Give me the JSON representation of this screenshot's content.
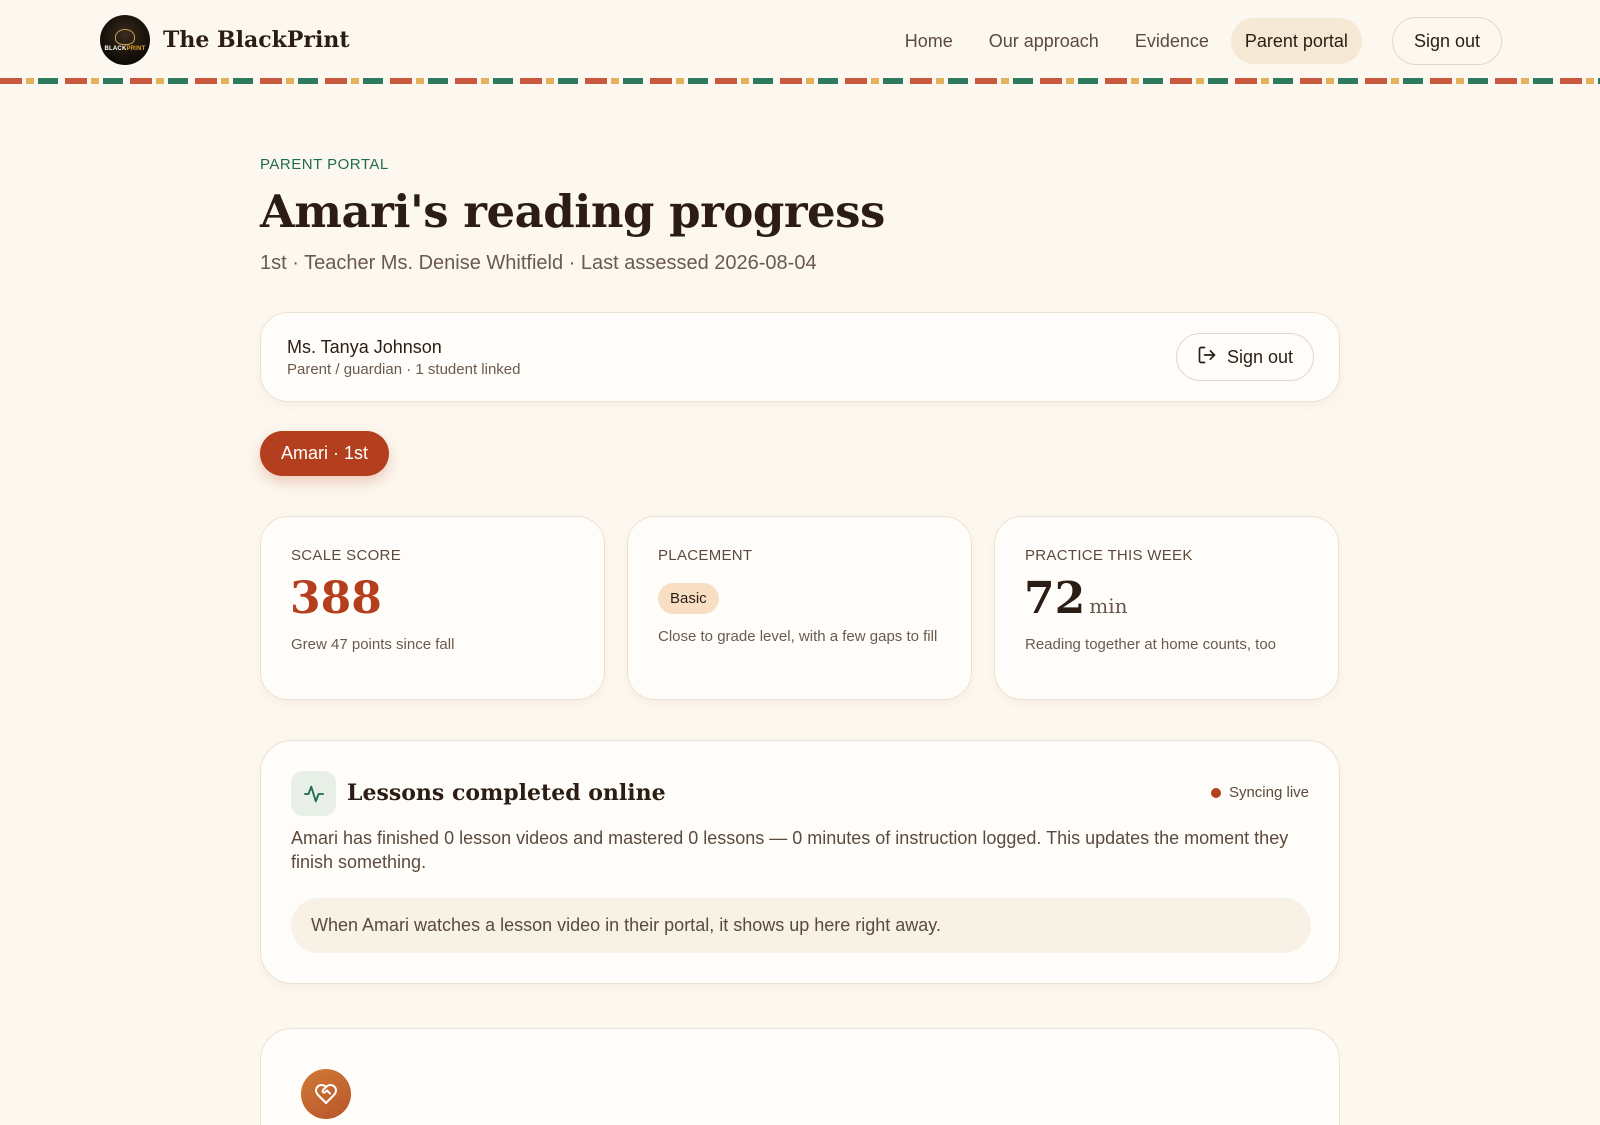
{
  "header": {
    "brand_name": "The BlackPrint",
    "logo_text_a": "BLACK",
    "logo_text_b": "PRINT",
    "nav": [
      {
        "label": "Home"
      },
      {
        "label": "Our approach"
      },
      {
        "label": "Evidence"
      },
      {
        "label": "Parent portal",
        "active": true
      }
    ],
    "signout_label": "Sign out"
  },
  "page": {
    "eyebrow": "PARENT PORTAL",
    "title": "Amari's reading progress",
    "subtitle": "1st · Teacher Ms. Denise Whitfield · Last assessed 2026-08-04"
  },
  "guardian": {
    "name": "Ms. Tanya Johnson",
    "role": "Parent / guardian · 1 student linked",
    "signout_label": "Sign out",
    "signout_icon": "sign-out-icon"
  },
  "student_tab": {
    "label": "Amari · 1st"
  },
  "stats": {
    "scale_score": {
      "label": "SCALE SCORE",
      "value": "388",
      "note": "Grew 47 points since fall"
    },
    "placement": {
      "label": "PLACEMENT",
      "badge": "Basic",
      "note": "Close to grade level, with a few gaps to fill"
    },
    "practice": {
      "label": "PRACTICE THIS WEEK",
      "value": "72",
      "unit": "min",
      "note": "Reading together at home counts, too"
    }
  },
  "lessons": {
    "icon": "activity-pulse-icon",
    "title": "Lessons completed online",
    "status": "Syncing live",
    "description": "Amari has finished 0 lesson videos and mastered 0 lessons — 0 minutes of instruction logged. This updates the moment they finish something.",
    "note": "When Amari watches a lesson video in their portal, it shows up here right away."
  },
  "next_card": {
    "icon": "heart-handshake-icon"
  },
  "colors": {
    "accent": "#b43f1e",
    "green": "#1f6b53",
    "background": "#fdf8ef",
    "stripe": [
      "#c8583e",
      "#e3b15a",
      "#2e7a5f"
    ]
  }
}
